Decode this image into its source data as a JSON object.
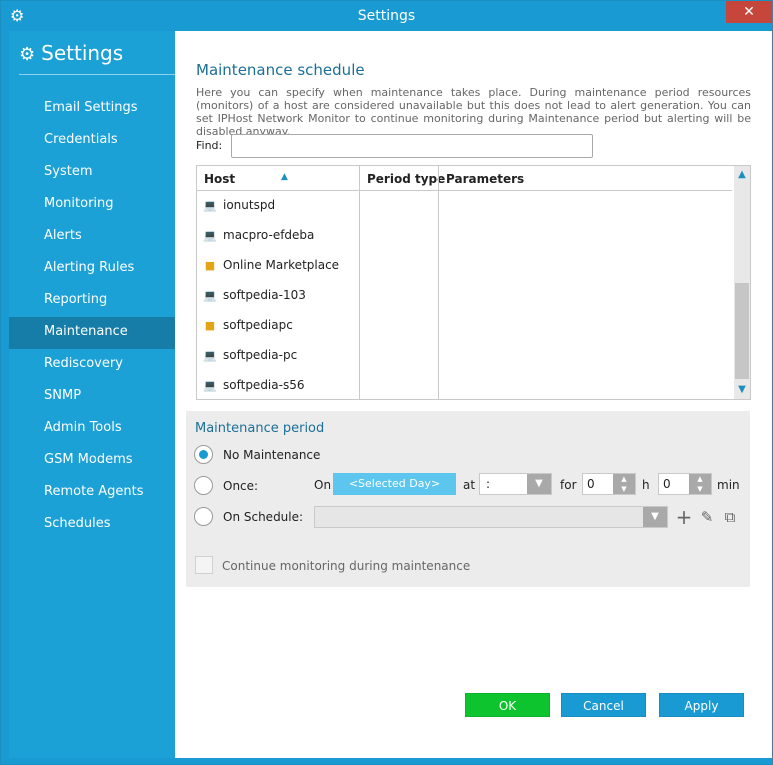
{
  "window": {
    "title": "Settings",
    "close_icon": "close-icon"
  },
  "sidebar": {
    "title": "Settings",
    "items": [
      {
        "label": "Email Settings"
      },
      {
        "label": "Credentials"
      },
      {
        "label": "System"
      },
      {
        "label": "Monitoring"
      },
      {
        "label": "Alerts"
      },
      {
        "label": "Alerting Rules"
      },
      {
        "label": "Reporting"
      },
      {
        "label": "Maintenance",
        "active": true
      },
      {
        "label": "Rediscovery"
      },
      {
        "label": "SNMP"
      },
      {
        "label": "Admin Tools"
      },
      {
        "label": "GSM Modems"
      },
      {
        "label": "Remote Agents"
      },
      {
        "label": "Schedules"
      }
    ]
  },
  "main": {
    "title": "Maintenance schedule",
    "description": "Here you can specify when maintenance takes place. During maintenance period resources (monitors) of a host are considered unavailable but this does not lead to alert generation. You can set IPHost Network Monitor to continue monitoring during Maintenance period but alerting will be disabled anyway.",
    "find_label": "Find:",
    "find_value": "",
    "columns": [
      "Host",
      "Period type",
      "Parameters"
    ],
    "rows": [
      {
        "host": "ionutspd",
        "icon": "laptop-icon"
      },
      {
        "host": "macpro-efdeba",
        "icon": "laptop-icon"
      },
      {
        "host": "Online Marketplace",
        "icon": "box-icon"
      },
      {
        "host": "softpedia-103",
        "icon": "laptop-icon"
      },
      {
        "host": "softpediapc",
        "icon": "box-icon"
      },
      {
        "host": "softpedia-pc",
        "icon": "laptop-icon"
      },
      {
        "host": "softpedia-s56",
        "icon": "laptop-icon"
      }
    ]
  },
  "period": {
    "title": "Maintenance period",
    "no_maintenance": "No Maintenance",
    "once": "Once:",
    "on_schedule": "On Schedule:",
    "on_label": "On",
    "day_button": "<Selected Day>",
    "at_label": "at",
    "at_value": ":",
    "for_label": "for",
    "hours_value": "0",
    "h_label": "h",
    "minutes_value": "0",
    "min_label": "min",
    "selected": "No Maintenance",
    "continue_label": "Continue monitoring during maintenance"
  },
  "buttons": {
    "ok": "OK",
    "cancel": "Cancel",
    "apply": "Apply"
  },
  "colors": {
    "accent": "#1a9ad2",
    "ok": "#0ec42e",
    "sidebar_active": "#167da8"
  }
}
